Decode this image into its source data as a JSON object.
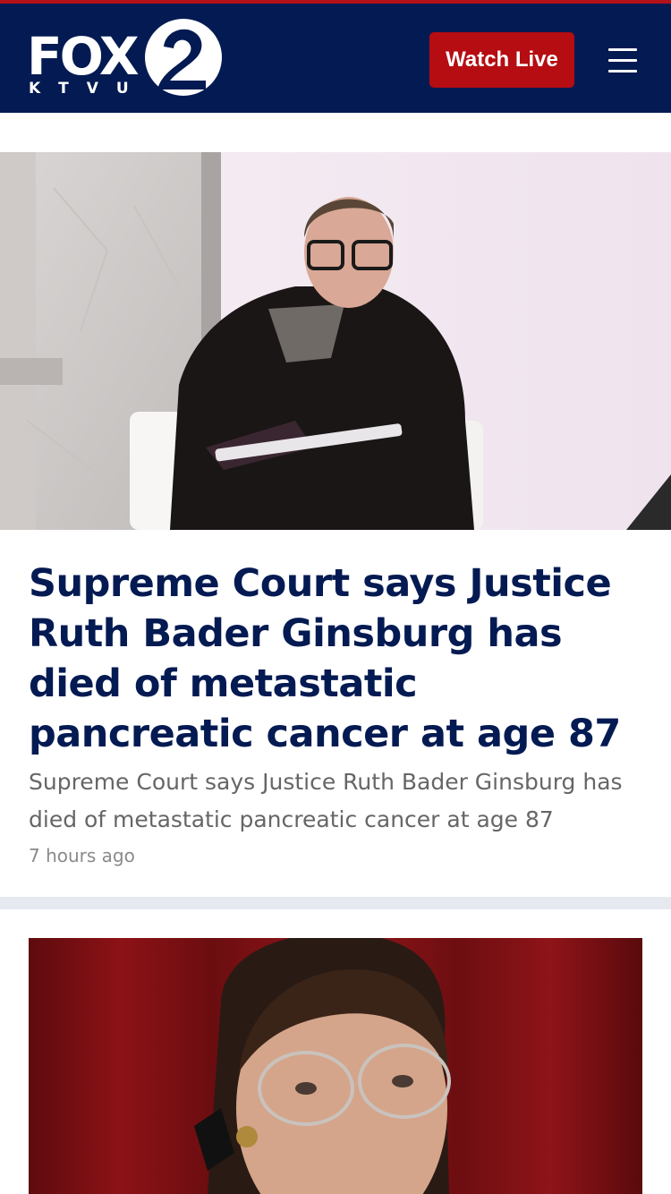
{
  "header": {
    "logo_primary": "FOX",
    "logo_numeral": "2",
    "logo_secondary": "KTVU",
    "watch_live_label": "Watch Live",
    "menu_icon": "hamburger-menu-icon"
  },
  "colors": {
    "header_bg": "#031a52",
    "accent_red": "#b50d12",
    "headline_navy": "#031a52",
    "summary_gray": "#666666",
    "divider": "#e6e9f0"
  },
  "article": {
    "headline": "Supreme Court says Justice Ruth Bader Ginsburg has died of metastatic pancreatic cancer at age 87",
    "summary": "Supreme Court says Justice Ruth Bader Ginsburg has died of metastatic pancreatic cancer at age 87",
    "timestamp": "7 hours ago"
  }
}
